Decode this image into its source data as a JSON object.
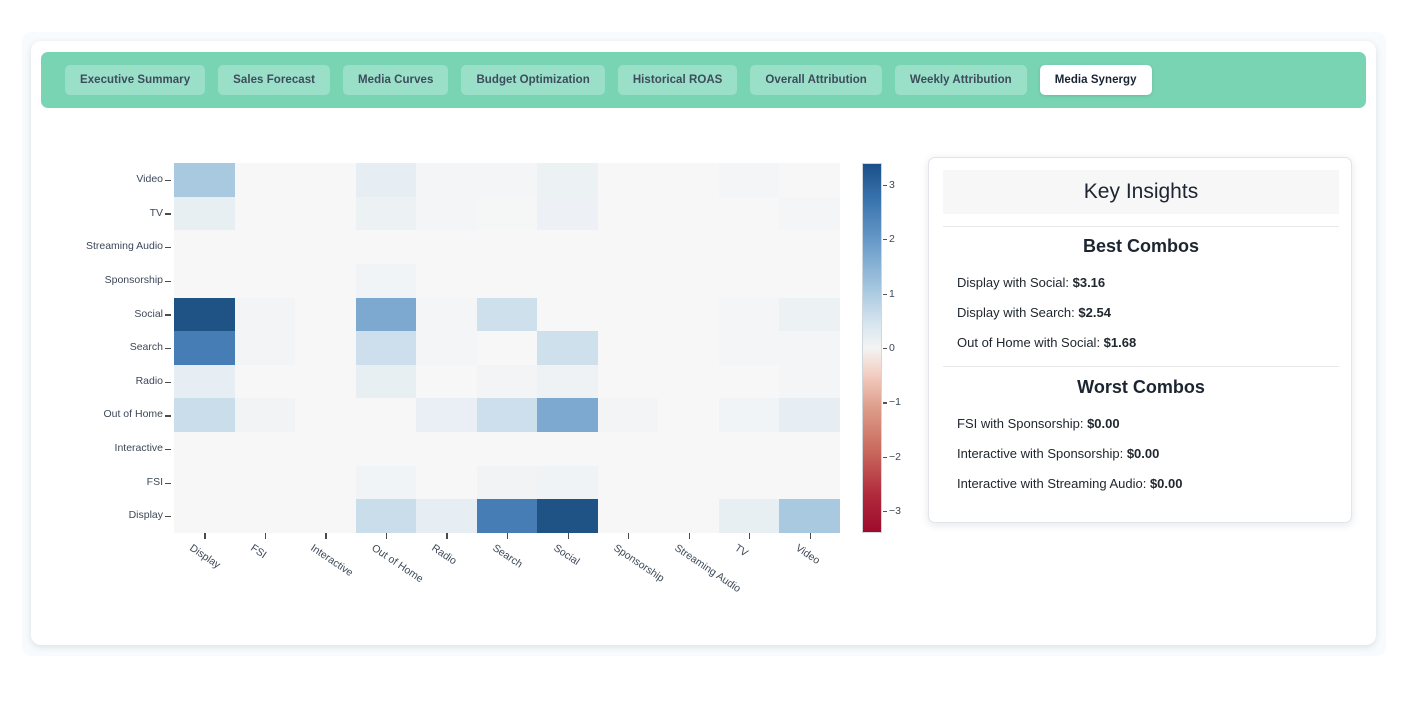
{
  "tabs": [
    {
      "label": "Executive Summary",
      "active": false
    },
    {
      "label": "Sales Forecast",
      "active": false
    },
    {
      "label": "Media Curves",
      "active": false
    },
    {
      "label": "Budget Optimization",
      "active": false
    },
    {
      "label": "Historical ROAS",
      "active": false
    },
    {
      "label": "Overall Attribution",
      "active": false
    },
    {
      "label": "Weekly Attribution",
      "active": false
    },
    {
      "label": "Media Synergy",
      "active": true
    }
  ],
  "insights": {
    "title": "Key Insights",
    "best_title": "Best Combos",
    "worst_title": "Worst Combos",
    "best": [
      {
        "label": "Display with Social: ",
        "value": "$3.16"
      },
      {
        "label": "Display with Search: ",
        "value": "$2.54"
      },
      {
        "label": "Out of Home with Social: ",
        "value": "$1.68"
      }
    ],
    "worst": [
      {
        "label": "FSI with Sponsorship: ",
        "value": "$0.00"
      },
      {
        "label": "Interactive with Sponsorship: ",
        "value": "$0.00"
      },
      {
        "label": "Interactive with Streaming Audio: ",
        "value": "$0.00"
      }
    ]
  },
  "colors": {
    "tabbar_bg": "#79d4b4",
    "tab_bg": "#9adfc7",
    "tab_active_bg": "#ffffff",
    "panel_bg": "#f7fbfd",
    "card_bg": "#ffffff",
    "cbar_low": "#9e0b2b",
    "cbar_mid": "#f7f7f7",
    "cbar_high": "#1a4f8a"
  },
  "chart_data": {
    "type": "heatmap",
    "title": "",
    "xlabel": "",
    "ylabel": "",
    "colorbar": {
      "label": "",
      "ticks": [
        3,
        2,
        1,
        0,
        -1,
        -2,
        -3
      ],
      "vmin": -3.4,
      "vmax": 3.4,
      "colormap": "RdBu"
    },
    "x": [
      "Display",
      "FSI",
      "Interactive",
      "Out of Home",
      "Radio",
      "Search",
      "Social",
      "Sponsorship",
      "Streaming Audio",
      "TV",
      "Video"
    ],
    "y": [
      "Video",
      "TV",
      "Streaming Audio",
      "Sponsorship",
      "Social",
      "Search",
      "Radio",
      "Out of Home",
      "Interactive",
      "FSI",
      "Display"
    ],
    "values": [
      [
        1.05,
        0.0,
        0.0,
        0.22,
        0.05,
        0.06,
        0.16,
        0.0,
        0.0,
        0.05,
        0.0
      ],
      [
        0.21,
        0.0,
        0.0,
        0.15,
        0.04,
        0.03,
        0.14,
        0.0,
        0.0,
        0.0,
        0.04
      ],
      [
        0.0,
        0.0,
        0.0,
        0.0,
        0.0,
        0.0,
        0.0,
        0.0,
        0.0,
        0.0,
        0.0
      ],
      [
        0.0,
        0.0,
        0.0,
        0.08,
        0.0,
        0.0,
        0.0,
        0.0,
        0.0,
        0.0,
        0.0
      ],
      [
        3.16,
        0.07,
        0.0,
        1.68,
        0.06,
        0.55,
        0.0,
        0.0,
        0.0,
        0.05,
        0.16
      ],
      [
        2.54,
        0.07,
        0.0,
        0.58,
        0.04,
        0.0,
        0.55,
        0.0,
        0.0,
        0.04,
        0.06
      ],
      [
        0.22,
        0.0,
        0.0,
        0.21,
        0.0,
        0.07,
        0.13,
        0.0,
        0.0,
        0.0,
        0.05
      ],
      [
        0.63,
        0.09,
        0.0,
        0.0,
        0.19,
        0.58,
        1.68,
        0.07,
        0.0,
        0.08,
        0.22
      ],
      [
        0.0,
        0.0,
        0.0,
        0.0,
        0.0,
        0.0,
        0.0,
        0.0,
        0.0,
        0.0,
        0.0
      ],
      [
        0.0,
        0.0,
        0.0,
        0.08,
        0.0,
        0.09,
        0.11,
        0.0,
        0.0,
        0.0,
        0.0
      ],
      [
        0.0,
        0.0,
        0.0,
        0.63,
        0.22,
        2.54,
        3.16,
        0.0,
        0.0,
        0.21,
        1.05
      ]
    ]
  }
}
